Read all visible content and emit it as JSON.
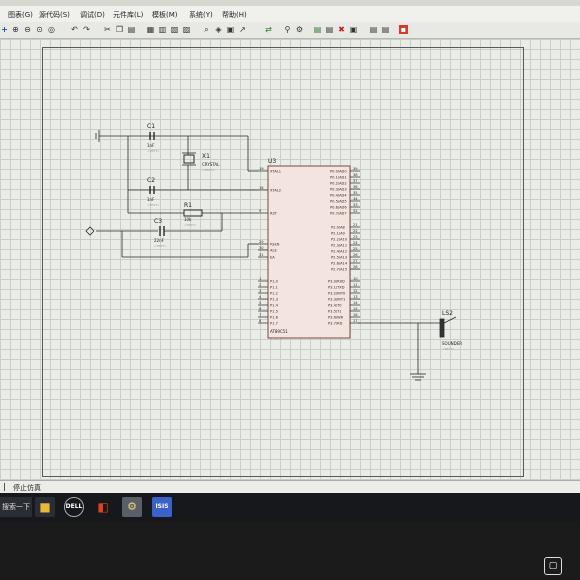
{
  "menu": [
    "图表(G)",
    "源代码(S)",
    "调试(D)",
    "元件库(L)",
    "模板(M)",
    "系统(Y)",
    "帮助(H)"
  ],
  "status": {
    "sim_text": "停止仿真"
  },
  "taskbar": {
    "search": "搜索一下"
  },
  "components": {
    "c1": {
      "ref": "C1",
      "value": "1nF",
      "text": "<TEXT>"
    },
    "c2": {
      "ref": "C2",
      "value": "1nF",
      "text": "<TEXT>"
    },
    "c3": {
      "ref": "C3",
      "value": "22nF",
      "text": "<TEXT>"
    },
    "x1": {
      "ref": "X1",
      "value": "CRYSTAL",
      "text": "<TEXT>"
    },
    "r1": {
      "ref": "R1",
      "value": "10k",
      "text": "<TEXT>"
    },
    "u3": {
      "ref": "U3",
      "part": "AT89C51",
      "text": "<TEXT>"
    },
    "ls2": {
      "ref": "LS2",
      "part": "SOUNDER",
      "text": "<TEXT>"
    }
  },
  "u3_left_pins": [
    {
      "num": "19",
      "name": "XTAL1"
    },
    {
      "num": "18",
      "name": "XTAL2"
    },
    {
      "num": "9",
      "name": "RST"
    },
    {
      "num": "29",
      "name": "PSEN"
    },
    {
      "num": "30",
      "name": "ALE"
    },
    {
      "num": "31",
      "name": "EA"
    },
    {
      "num": "1",
      "name": "P1.0"
    },
    {
      "num": "2",
      "name": "P1.1"
    },
    {
      "num": "3",
      "name": "P1.2"
    },
    {
      "num": "4",
      "name": "P1.3"
    },
    {
      "num": "5",
      "name": "P1.4"
    },
    {
      "num": "6",
      "name": "P1.5"
    },
    {
      "num": "7",
      "name": "P1.6"
    },
    {
      "num": "8",
      "name": "P1.7"
    }
  ],
  "u3_right_pins": [
    {
      "num": "39",
      "name": "P0.0/AD0"
    },
    {
      "num": "38",
      "name": "P0.1/AD1"
    },
    {
      "num": "37",
      "name": "P0.2/AD2"
    },
    {
      "num": "36",
      "name": "P0.3/AD3"
    },
    {
      "num": "35",
      "name": "P0.4/AD4"
    },
    {
      "num": "34",
      "name": "P0.5/AD5"
    },
    {
      "num": "33",
      "name": "P0.6/AD6"
    },
    {
      "num": "32",
      "name": "P0.7/AD7"
    },
    {
      "num": "21",
      "name": "P2.0/A8"
    },
    {
      "num": "22",
      "name": "P2.1/A9"
    },
    {
      "num": "23",
      "name": "P2.2/A10"
    },
    {
      "num": "24",
      "name": "P2.3/A11"
    },
    {
      "num": "25",
      "name": "P2.4/A12"
    },
    {
      "num": "26",
      "name": "P2.5/A13"
    },
    {
      "num": "27",
      "name": "P2.6/A14"
    },
    {
      "num": "28",
      "name": "P2.7/A15"
    },
    {
      "num": "10",
      "name": "P3.0/RXD"
    },
    {
      "num": "11",
      "name": "P3.1/TXD"
    },
    {
      "num": "12",
      "name": "P3.2/INT0"
    },
    {
      "num": "13",
      "name": "P3.3/INT1"
    },
    {
      "num": "14",
      "name": "P3.4/T0"
    },
    {
      "num": "15",
      "name": "P3.5/T1"
    },
    {
      "num": "16",
      "name": "P3.6/WR"
    },
    {
      "num": "17",
      "name": "P3.7/RD"
    }
  ]
}
